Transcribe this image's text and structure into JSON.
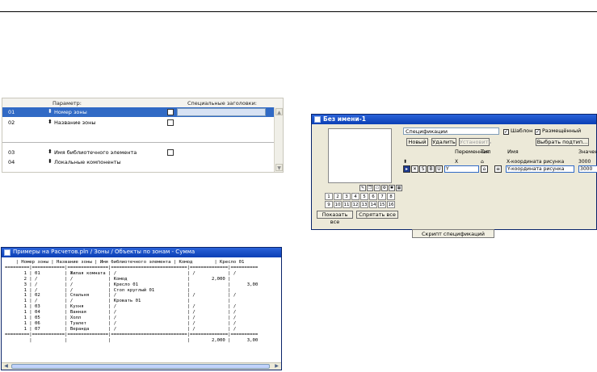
{
  "param_panel": {
    "header_param": "Параметр:",
    "header_special": "Специальные заголовки:",
    "rows": [
      {
        "id": "01",
        "name": "Номер зоны"
      },
      {
        "id": "02",
        "name": "Название зоны"
      },
      {
        "id": "03",
        "name": "Имя библиотечного элемента"
      },
      {
        "id": "04",
        "name": "Локальные компоненты"
      }
    ],
    "arrow_glyph": "⬍"
  },
  "spec_window": {
    "title": "Без имени-1",
    "spec_name": "Спецификации",
    "template_label": "Шаблон",
    "placed_label": "Размещённый",
    "new_button": "Новый",
    "delete_button": "Удалить",
    "set_button": "Установить",
    "choose_button": "Выбрать подтип...",
    "show_all_button": "Показать все",
    "hide_all_button": "Спрятать все",
    "col_variable": "Переменная",
    "col_type": "Тип",
    "col_name": "Имя",
    "col_value": "Значени",
    "row1": {
      "var": "X",
      "name": "X-координата рисунка",
      "value": "3000"
    },
    "row2": {
      "var": "Y",
      "name": "Y-координата рисунка",
      "value": "3000"
    },
    "number_buttons": [
      "1",
      "2",
      "3",
      "4",
      "5",
      "6",
      "7",
      "8",
      "9",
      "10",
      "11",
      "12",
      "13",
      "14",
      "15",
      "16"
    ],
    "tool_icons": [
      "pencil-icon",
      "copy-icon",
      "view-icon",
      "settings-icon",
      "gear-icon",
      "grid-icon"
    ]
  },
  "script_button": "Скрипт спецификаций",
  "listing_window": {
    "title": "Примеры на Расчетов.pln / Зоны / Объекты по зонам - Сумма",
    "text": "    | Номер зоны | Название зоны | Имя библиотечного элемента | Комод        | Кресло 01\n=========|============|===============|============================|==============|==========\n       1 | 01         | Жилая комната | /                          | /            | /\n       2 | /          | /             | Комод                      |        2,000 |\n       3 | /          | /             | Кресло 01                  |              |      3,00\n       1 | /          | /             | Стол круглый 01            |              |\n       1 | 02         | Спальня       | /                          | /            | /\n       1 | /          | /             | Кровать 01                 |              |\n       1 | 03         | Кухня         | /                          | /            | /\n       1 | 04         | Ванная        | /                          | /            | /\n       1 | 05         | Холл          | /                          | /            | /\n       1 | 06         | Туалет        | /                          | /            | /\n       1 | 07         | Веранда       | /                          | /            | /\n=========|============|===============|============================|==============|==========\n         |            |               |                            |        2,000 |      3,00"
  }
}
